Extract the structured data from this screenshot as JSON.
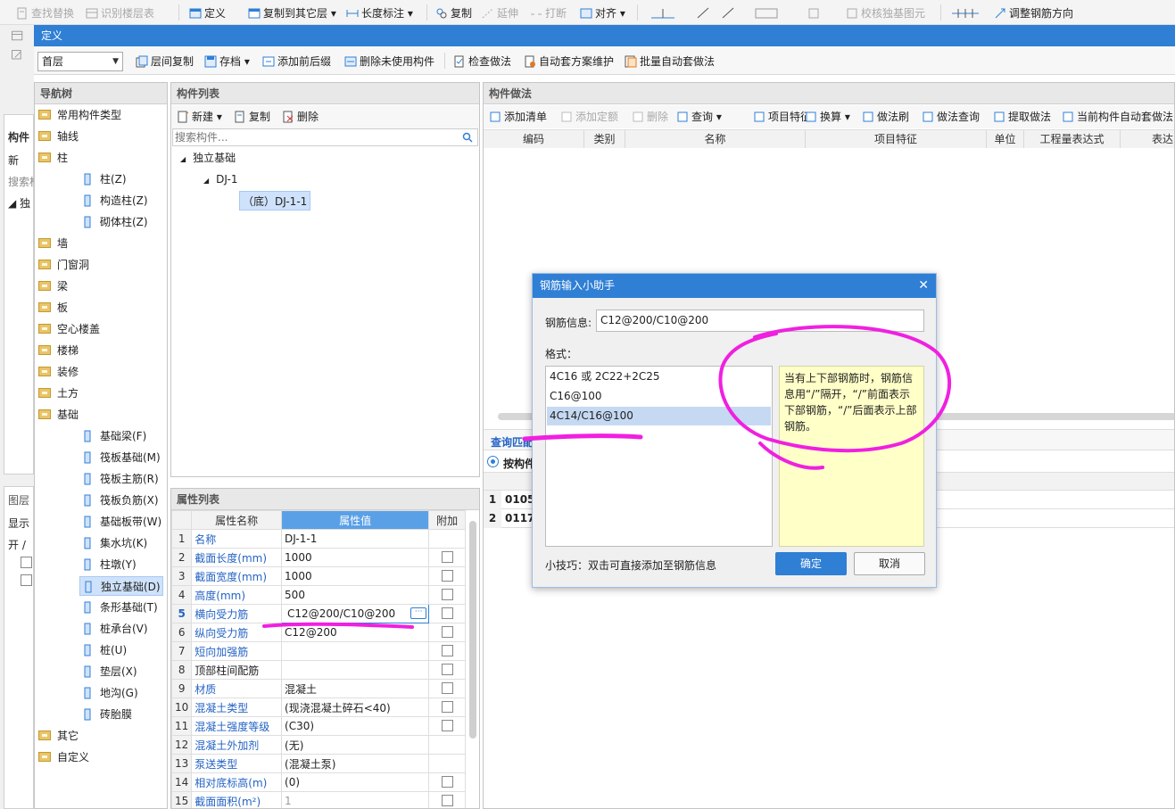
{
  "top_toolbar": {
    "find_replace": "查找替换",
    "identify_floor": "识别楼层表",
    "define": "定义",
    "copy_to_floor": "复制到其它层",
    "length_dim": "长度标注",
    "copy": "复制",
    "extend": "延伸",
    "break": "打断",
    "align": "对齐",
    "check_foundation": "校核独基图元",
    "adjust_rebar": "调整钢筋方向"
  },
  "window": {
    "title": "定义"
  },
  "define_toolbar": {
    "floor": "首层",
    "floor_copy": "层间复制",
    "save": "存档",
    "add_prefix": "添加前后缀",
    "delete_unused": "删除未使用构件",
    "check_method": "检查做法",
    "auto_plan": "自动套方案维护",
    "batch_auto": "批量自动套做法"
  },
  "background": {
    "component": "构件",
    "new": "新",
    "search": "搜索构",
    "layer": "图层",
    "show": "显示",
    "open": "开 /"
  },
  "nav_tree": {
    "title": "导航树",
    "items": [
      {
        "label": "常用构件类型",
        "level": 0
      },
      {
        "label": "轴线",
        "level": 0
      },
      {
        "label": "柱",
        "level": 0
      },
      {
        "label": "柱(Z)",
        "level": 1
      },
      {
        "label": "构造柱(Z)",
        "level": 1
      },
      {
        "label": "砌体柱(Z)",
        "level": 1
      },
      {
        "label": "墙",
        "level": 0
      },
      {
        "label": "门窗洞",
        "level": 0
      },
      {
        "label": "梁",
        "level": 0
      },
      {
        "label": "板",
        "level": 0
      },
      {
        "label": "空心楼盖",
        "level": 0
      },
      {
        "label": "楼梯",
        "level": 0
      },
      {
        "label": "装修",
        "level": 0
      },
      {
        "label": "土方",
        "level": 0
      },
      {
        "label": "基础",
        "level": 0
      },
      {
        "label": "基础梁(F)",
        "level": 1
      },
      {
        "label": "筏板基础(M)",
        "level": 1
      },
      {
        "label": "筏板主筋(R)",
        "level": 1
      },
      {
        "label": "筏板负筋(X)",
        "level": 1
      },
      {
        "label": "基础板带(W)",
        "level": 1
      },
      {
        "label": "集水坑(K)",
        "level": 1
      },
      {
        "label": "柱墩(Y)",
        "level": 1
      },
      {
        "label": "独立基础(D)",
        "level": 1,
        "selected": true
      },
      {
        "label": "条形基础(T)",
        "level": 1
      },
      {
        "label": "桩承台(V)",
        "level": 1
      },
      {
        "label": "桩(U)",
        "level": 1
      },
      {
        "label": "垫层(X)",
        "level": 1
      },
      {
        "label": "地沟(G)",
        "level": 1
      },
      {
        "label": "砖胎膜",
        "level": 1
      },
      {
        "label": "其它",
        "level": 0
      },
      {
        "label": "自定义",
        "level": 0
      }
    ]
  },
  "component_list": {
    "title": "构件列表",
    "new": "新建",
    "copy": "复制",
    "delete": "删除",
    "search_placeholder": "搜索构件...",
    "tree": {
      "root": "独立基础",
      "child": "DJ-1",
      "leaf": "（底）DJ-1-1"
    }
  },
  "property_list": {
    "title": "属性列表",
    "headers": [
      "属性名称",
      "属性值",
      "附加"
    ],
    "rows": [
      {
        "n": "1",
        "name": "名称",
        "value": "DJ-1-1",
        "cb": false
      },
      {
        "n": "2",
        "name": "截面长度(mm)",
        "value": "1000",
        "cb": true
      },
      {
        "n": "3",
        "name": "截面宽度(mm)",
        "value": "1000",
        "cb": true
      },
      {
        "n": "4",
        "name": "高度(mm)",
        "value": "500",
        "cb": true
      },
      {
        "n": "5",
        "name": "横向受力筋",
        "value": "C12@200/C10@200",
        "cb": true,
        "editing": true
      },
      {
        "n": "6",
        "name": "纵向受力筋",
        "value": "C12@200",
        "cb": true
      },
      {
        "n": "7",
        "name": "短向加强筋",
        "value": "",
        "cb": true
      },
      {
        "n": "8",
        "name": "顶部柱间配筋",
        "value": "",
        "cb": true,
        "black": true
      },
      {
        "n": "9",
        "name": "材质",
        "value": "混凝土",
        "cb": true
      },
      {
        "n": "10",
        "name": "混凝土类型",
        "value": "(现浇混凝土碎石<40)",
        "cb": true
      },
      {
        "n": "11",
        "name": "混凝土强度等级",
        "value": "(C30)",
        "cb": true
      },
      {
        "n": "12",
        "name": "混凝土外加剂",
        "value": "(无)",
        "cb": false
      },
      {
        "n": "13",
        "name": "泵送类型",
        "value": "(混凝土泵)",
        "cb": false
      },
      {
        "n": "14",
        "name": "相对底标高(m)",
        "value": "(0)",
        "cb": true
      },
      {
        "n": "15",
        "name": "截面面积(m²)",
        "value": "1",
        "cb": true,
        "grey": true
      }
    ]
  },
  "method_panel": {
    "title": "构件做法",
    "toolbar": [
      "添加清单",
      "添加定额",
      "删除",
      "查询",
      "项目特征",
      "换算",
      "做法刷",
      "做法查询",
      "提取做法",
      "当前构件自动套做法"
    ],
    "columns": [
      "编码",
      "类别",
      "名称",
      "项目特征",
      "单位",
      "工程量表达式",
      "表达"
    ],
    "query_tab": "查询匹配",
    "by_component": "按构件",
    "rows": [
      {
        "n": "1",
        "code": "0105"
      },
      {
        "n": "2",
        "code": "0117"
      }
    ]
  },
  "dialog": {
    "title": "钢筋输入小助手",
    "rebar_label": "钢筋信息:",
    "rebar_value": "C12@200/C10@200",
    "format_label": "格式：",
    "formats": [
      "4C16 或 2C22+2C25",
      "C16@100",
      "4C14/C16@100"
    ],
    "selected_index": 2,
    "tip_text": "当有上下部钢筋时，钢筋信息用“/”隔开，“/”前面表示下部钢筋，“/”后面表示上部钢筋。",
    "hint": "小技巧：双击可直接添加至钢筋信息",
    "ok": "确定",
    "cancel": "取消"
  }
}
